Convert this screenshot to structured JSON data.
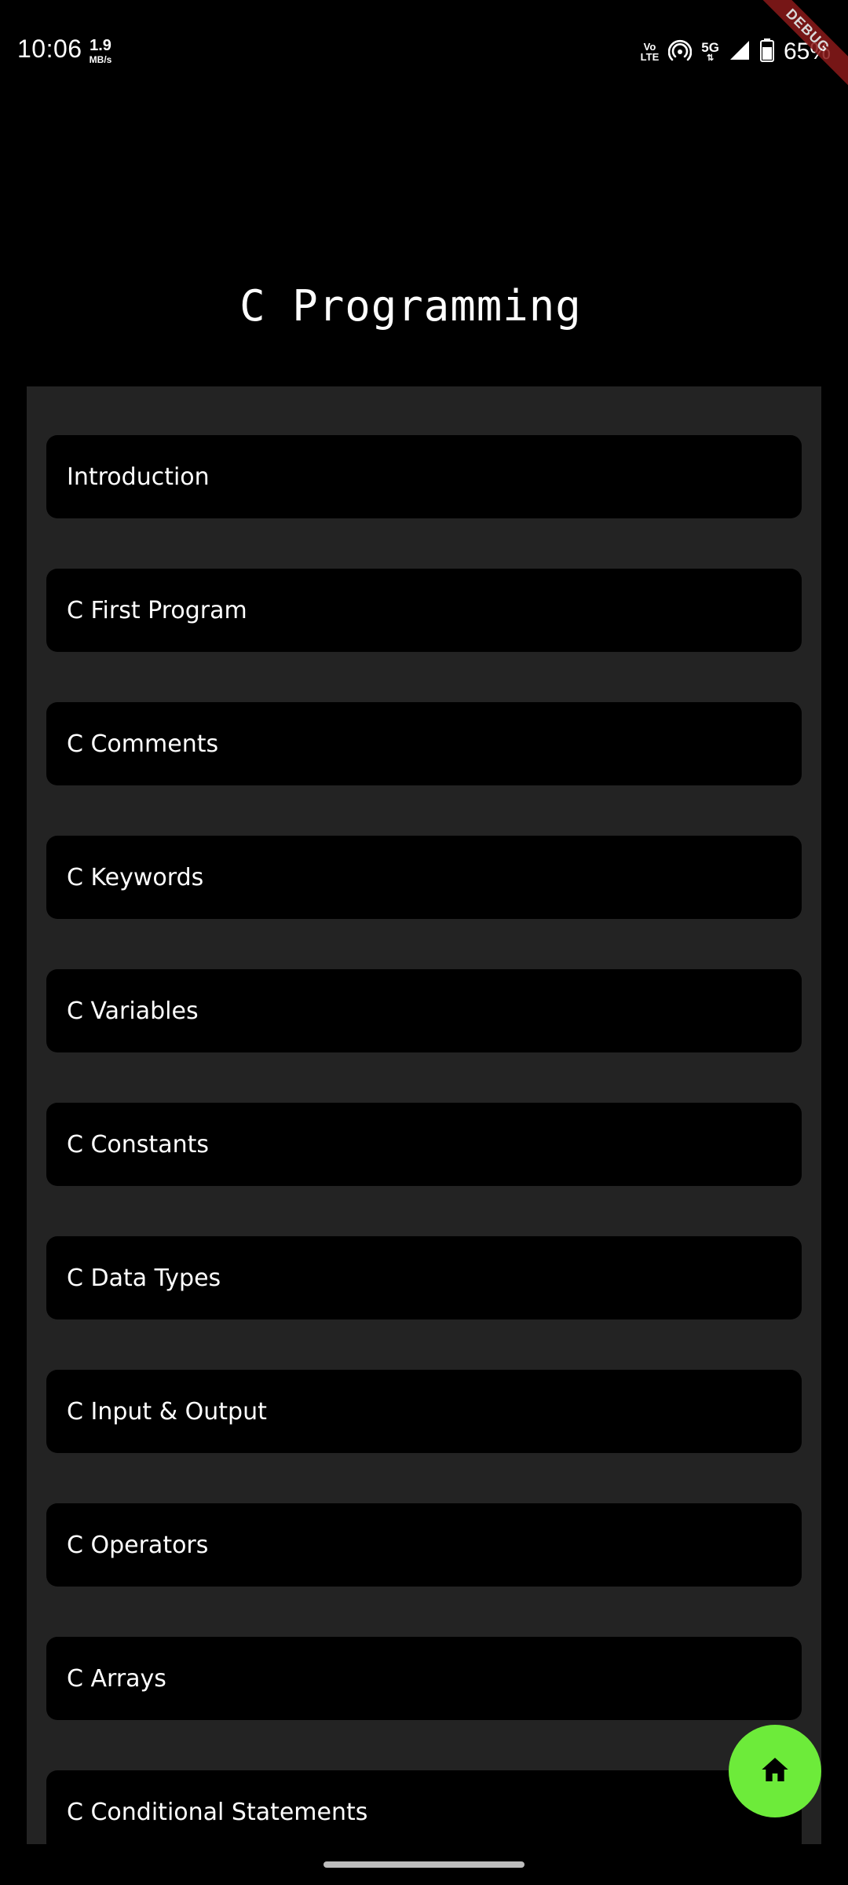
{
  "status_bar": {
    "time": "10:06",
    "speed_value": "1.9",
    "speed_unit": "MB/s",
    "volte_top": "Vo",
    "volte_bottom": "LTE",
    "network": "5G",
    "battery": "65%"
  },
  "debug_banner": {
    "label": "DEBUG"
  },
  "page": {
    "title": "C Programming"
  },
  "topics": [
    {
      "label": "Introduction"
    },
    {
      "label": "C First Program"
    },
    {
      "label": "C Comments"
    },
    {
      "label": "C Keywords"
    },
    {
      "label": "C Variables"
    },
    {
      "label": "C Constants"
    },
    {
      "label": "C Data Types"
    },
    {
      "label": "C Input & Output"
    },
    {
      "label": "C Operators"
    },
    {
      "label": "C Arrays"
    },
    {
      "label": "C Conditional Statements"
    }
  ],
  "fab": {
    "icon": "home-icon",
    "color": "#6deb3a"
  },
  "colors": {
    "background": "#000000",
    "panel": "#232323",
    "item": "#000000",
    "text": "#ffffff"
  }
}
